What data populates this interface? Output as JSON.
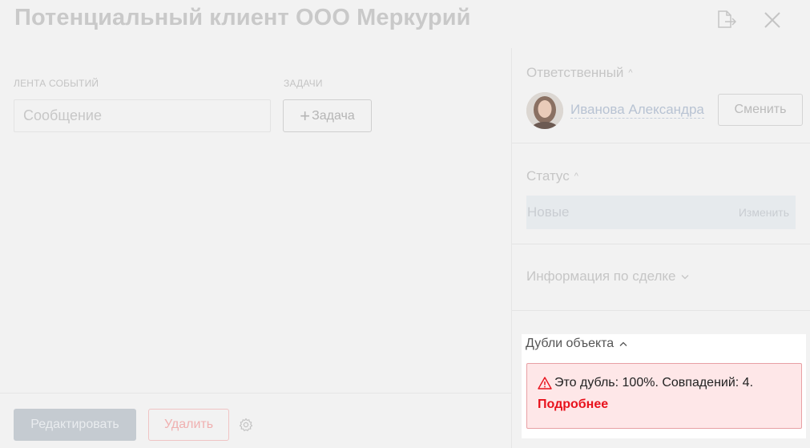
{
  "header": {
    "title": "Потенциальный клиент ООО Меркурий"
  },
  "left": {
    "feed_label": "ЛЕНТА СОБЫТИЙ",
    "tasks_label": "ЗАДАЧИ",
    "message_placeholder": "Сообщение",
    "task_button_label": "Задача"
  },
  "footer": {
    "edit_label": "Редактировать",
    "delete_label": "Удалить"
  },
  "responsible": {
    "heading": "Ответственный",
    "name": "Иванова Александра",
    "change_label": "Сменить"
  },
  "status": {
    "heading": "Статус",
    "value": "Новые",
    "edit_label": "Изменить"
  },
  "deal_info": {
    "heading": "Информация по сделке"
  },
  "duplicates": {
    "heading": "Дубли объекта",
    "alert_text": "Это дубль: 100%. Совпадений: 4.",
    "more_label": "Подробнее"
  },
  "colors": {
    "alert_red": "#e8121c",
    "alert_bg": "#fee7e8"
  },
  "icons": [
    "export-icon",
    "close-icon",
    "plus-icon",
    "settings-icon",
    "chevron-up-icon",
    "chevron-down-icon",
    "warning-icon"
  ]
}
